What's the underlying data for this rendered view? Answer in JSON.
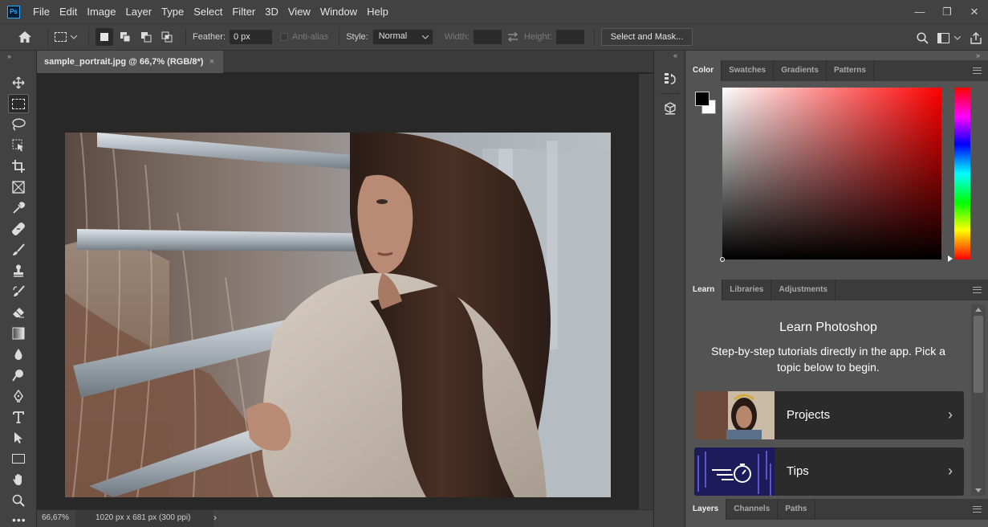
{
  "app": {
    "logo": "Ps"
  },
  "menu": [
    "File",
    "Edit",
    "Image",
    "Layer",
    "Type",
    "Select",
    "Filter",
    "3D",
    "View",
    "Window",
    "Help"
  ],
  "window_controls": {
    "minimize": "—",
    "restore": "❐",
    "close": "✕"
  },
  "options": {
    "feather_label": "Feather:",
    "feather_value": "0 px",
    "antialias_label": "Anti-alias",
    "style_label": "Style:",
    "style_value": "Normal",
    "width_label": "Width:",
    "height_label": "Height:",
    "select_mask": "Select and Mask..."
  },
  "document": {
    "tab_title": "sample_portrait.jpg @ 66,7% (RGB/8*)",
    "close": "×",
    "zoom": "66,67%",
    "info": "1020 px x 681 px (300 ppi)",
    "info_arrow": "›"
  },
  "panels": {
    "color_tabs": [
      "Color",
      "Swatches",
      "Gradients",
      "Patterns"
    ],
    "learn_tabs": [
      "Learn",
      "Libraries",
      "Adjustments"
    ],
    "layers_tabs": [
      "Layers",
      "Channels",
      "Paths"
    ],
    "learn": {
      "title": "Learn Photoshop",
      "subtitle": "Step-by-step tutorials directly in the app. Pick a topic below to begin.",
      "cards": [
        {
          "label": "Projects",
          "chevron": "›"
        },
        {
          "label": "Tips",
          "chevron": "›"
        }
      ]
    }
  },
  "colors": {
    "foreground": "#000000",
    "background": "#ffffff",
    "picker_hue": "#ff0000"
  }
}
